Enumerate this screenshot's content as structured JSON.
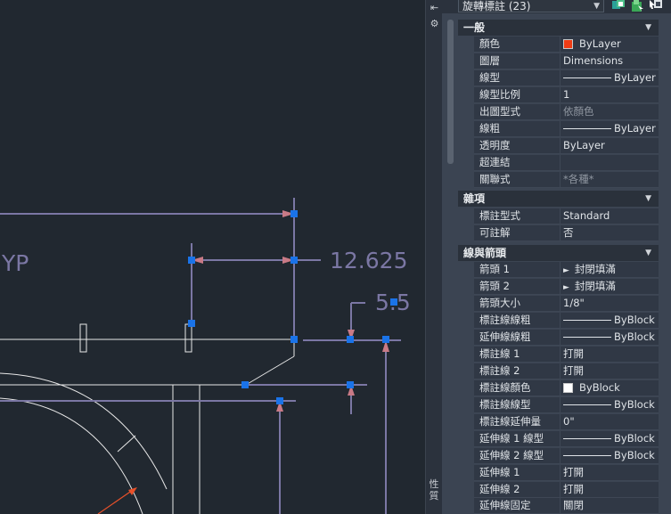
{
  "drawing": {
    "label_typ": "YP",
    "dim_12625": "12.625",
    "dim_55": "5.5"
  },
  "sidebar": {
    "title": "性質"
  },
  "header": {
    "object_selector": "旋轉標註 (23)"
  },
  "sections": {
    "general": {
      "title": "一般",
      "rows": [
        {
          "label": "顏色",
          "value": "ByLayer"
        },
        {
          "label": "圖層",
          "value": "Dimensions"
        },
        {
          "label": "線型",
          "value": "ByLayer"
        },
        {
          "label": "線型比例",
          "value": "1"
        },
        {
          "label": "出圖型式",
          "value": "依顏色"
        },
        {
          "label": "線粗",
          "value": "ByLayer"
        },
        {
          "label": "透明度",
          "value": "ByLayer"
        },
        {
          "label": "超連結",
          "value": ""
        },
        {
          "label": "關聯式",
          "value": "*各種*"
        }
      ]
    },
    "misc": {
      "title": "雜項",
      "rows": [
        {
          "label": "標註型式",
          "value": "Standard"
        },
        {
          "label": "可註解",
          "value": "否"
        }
      ]
    },
    "lines_arrows": {
      "title": "線與箭頭",
      "rows": [
        {
          "label": "箭頭 1",
          "value": "封閉填滿"
        },
        {
          "label": "箭頭 2",
          "value": "封閉填滿"
        },
        {
          "label": "箭頭大小",
          "value": "1/8\""
        },
        {
          "label": "標註線線粗",
          "value": "ByBlock"
        },
        {
          "label": "延伸線線粗",
          "value": "ByBlock"
        },
        {
          "label": "標註線 1",
          "value": "打開"
        },
        {
          "label": "標註線 2",
          "value": "打開"
        },
        {
          "label": "標註線顏色",
          "value": "ByBlock"
        },
        {
          "label": "標註線線型",
          "value": "ByBlock"
        },
        {
          "label": "標註線延伸量",
          "value": "0\""
        },
        {
          "label": "延伸線 1 線型",
          "value": "ByBlock"
        },
        {
          "label": "延伸線 2 線型",
          "value": "ByBlock"
        },
        {
          "label": "延伸線 1",
          "value": "打開"
        },
        {
          "label": "延伸線 2",
          "value": "打開"
        },
        {
          "label": "延伸線固定",
          "value": "關閉"
        }
      ]
    }
  },
  "colors": {
    "bylayer_swatch": "#f03c14",
    "byblock_swatch": "#ffffff",
    "grip": "#1a73e8",
    "dimension_line": "#7b77a4",
    "arrowhead": "#c97a86"
  },
  "icons": {
    "quick_select": "quick-select-icon",
    "select_objects": "select-objects-icon",
    "pickadd": "pickadd-toggle-icon",
    "close": "close-icon",
    "settings": "gear-icon"
  }
}
